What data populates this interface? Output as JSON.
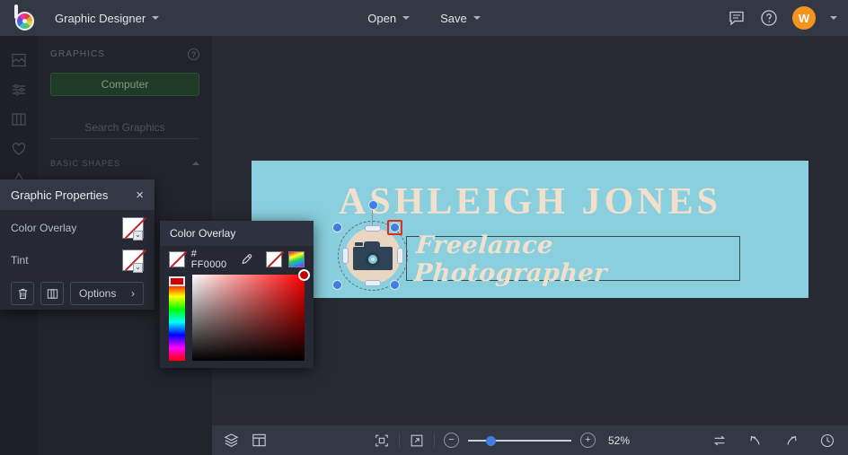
{
  "topbar": {
    "logo_name": "color-wheel-logo",
    "project_name": "Graphic Designer",
    "open_label": "Open",
    "save_label": "Save",
    "chat_icon": "chat-icon",
    "help_icon": "help-icon",
    "avatar_initial": "W"
  },
  "rail": {
    "items": [
      {
        "name": "image-frame-icon",
        "label": "Photo"
      },
      {
        "name": "adjust-sliders-icon",
        "label": "Adjust"
      },
      {
        "name": "columns-layout-icon",
        "label": "Layout"
      },
      {
        "name": "heart-icon",
        "label": "Favorites"
      },
      {
        "name": "triangle-shape-icon",
        "label": "Shapes"
      }
    ]
  },
  "graphics_panel": {
    "title": "GRAPHICS",
    "help_glyph": "?",
    "computer_button": "Computer",
    "search_placeholder": "Search Graphics",
    "section_label": "BASIC SHAPES"
  },
  "graphic_properties": {
    "title": "Graphic Properties",
    "close_glyph": "×",
    "rows": [
      {
        "label": "Color Overlay",
        "value": "none"
      },
      {
        "label": "Tint",
        "value": "none"
      }
    ],
    "delete_icon": "trash-icon",
    "duplicate_icon": "duplicate-icon",
    "options_label": "Options",
    "options_chevron": "›"
  },
  "color_overlay": {
    "title": "Color Overlay",
    "hex_value": "# FF0000",
    "eyedropper_icon": "eyedropper-icon",
    "none_swatch": "no-color-swatch",
    "wheel_swatch": "color-wheel-swatch",
    "accent_color": "#FF0000"
  },
  "canvas": {
    "banner_bg": "#89CFDD",
    "title_text": "ASHLEIGH JONES",
    "title_color": "#F2E0CD",
    "subtitle_text": "Freelance Photographer",
    "graphic_name": "camera-graphic",
    "selected_handle": "top-right-handle"
  },
  "bottombar": {
    "layers_icon": "layers-icon",
    "grid_icon": "grid-layout-icon",
    "fit_icon": "fit-to-screen-icon",
    "expand_icon": "expand-icon",
    "zoom_out_glyph": "−",
    "zoom_in_glyph": "+",
    "zoom_level": "52%",
    "swap_icon": "swap-icon",
    "undo_icon": "undo-icon",
    "redo_icon": "redo-icon",
    "history_icon": "history-clock-icon"
  }
}
